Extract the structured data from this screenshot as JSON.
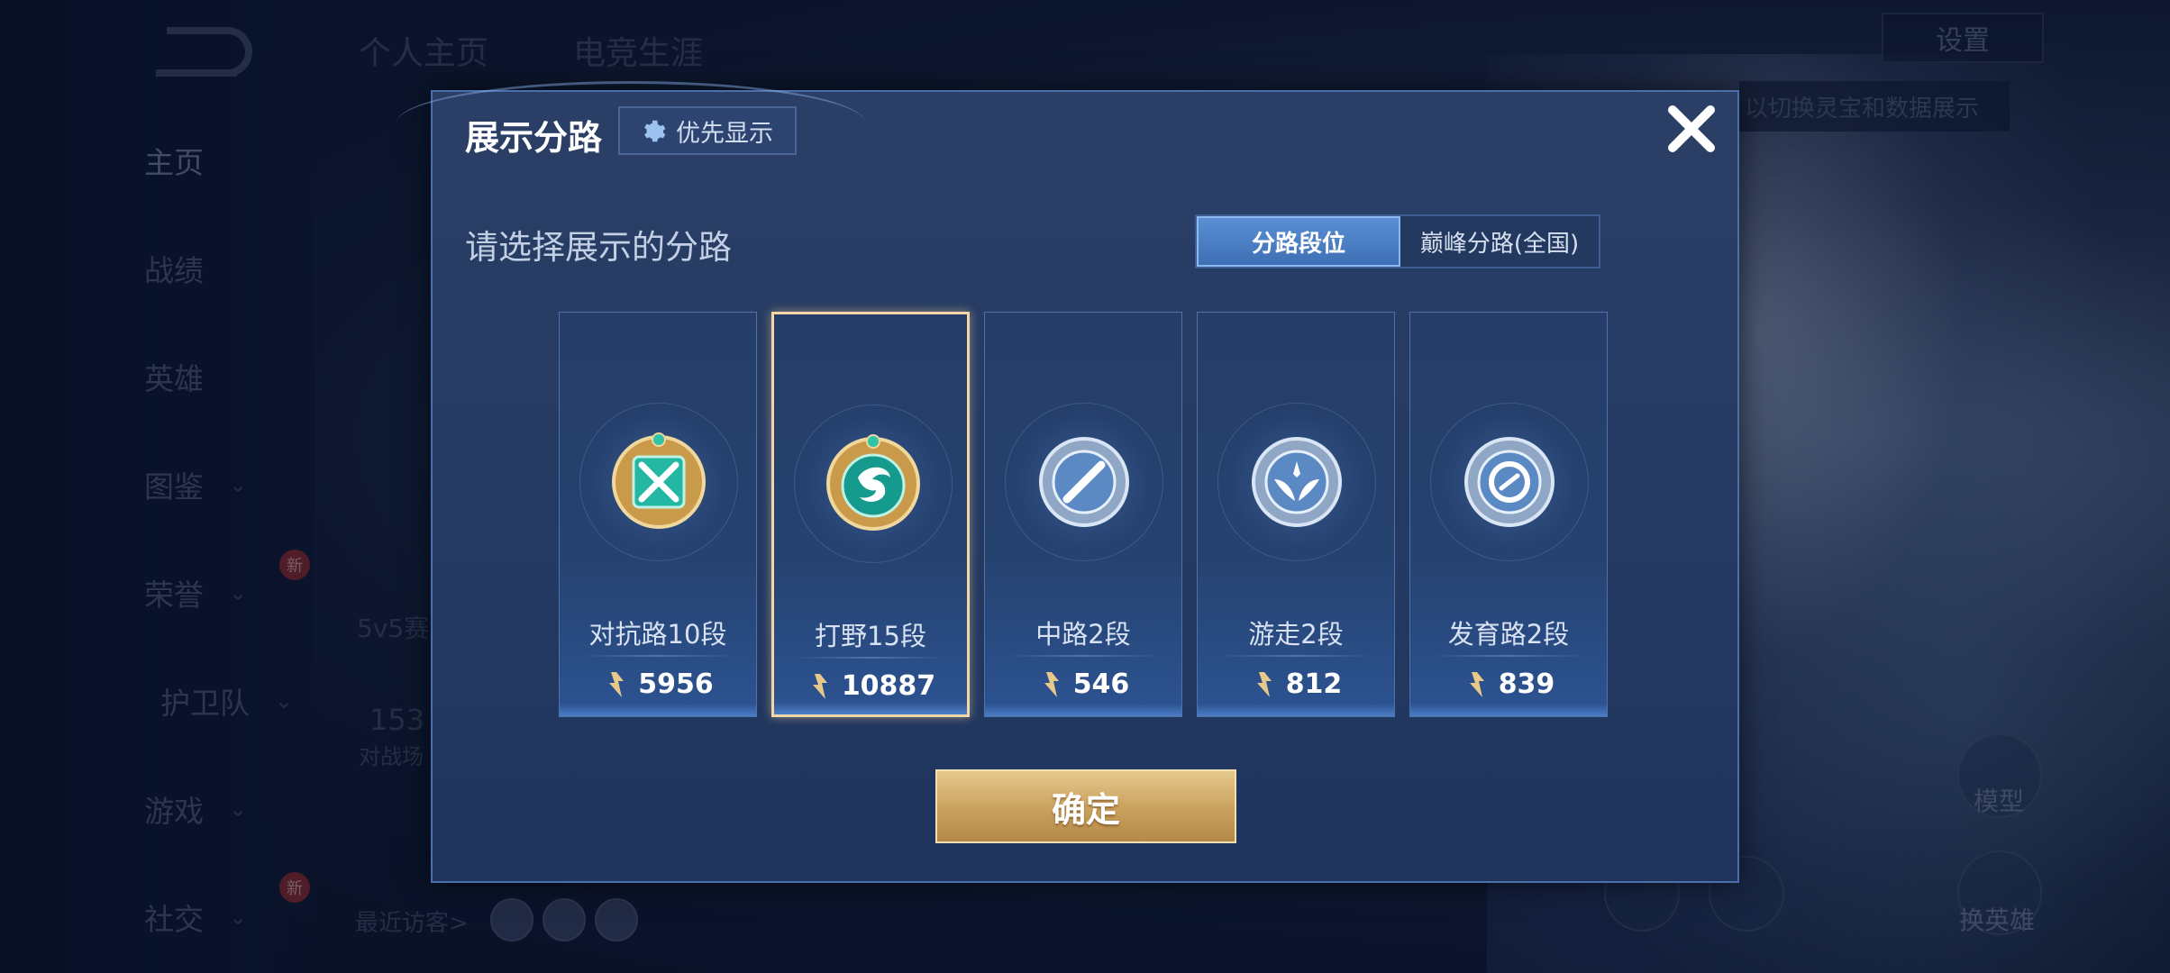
{
  "background": {
    "top_tabs": [
      "个人主页",
      "电竞生涯"
    ],
    "settings_label": "设置",
    "switch_tip": "以切换灵宝和数据展示",
    "sidebar": [
      {
        "label": "主页",
        "active": true
      },
      {
        "label": "战绩"
      },
      {
        "label": "英雄"
      },
      {
        "label": "图鉴",
        "chevron": true
      },
      {
        "label": "荣誉",
        "chevron": true,
        "badge": "新"
      },
      {
        "label": "护卫队",
        "chevron": true
      },
      {
        "label": "游戏",
        "chevron": true
      },
      {
        "label": "社交",
        "chevron": true,
        "badge": "新"
      }
    ],
    "stat_fragment": "5v5赛",
    "count_fragment": "153",
    "count_label_fragment": "对战场",
    "recent_visitors": "最近访客>",
    "right_labels": {
      "model": "模型",
      "switch_hero": "换英雄"
    }
  },
  "modal": {
    "title": "展示分路",
    "priority_label": "优先显示",
    "subtitle": "请选择展示的分路",
    "tabs": [
      {
        "label": "分路段位",
        "active": true
      },
      {
        "label": "巅峰分路(全国)",
        "active": false
      }
    ],
    "lanes": [
      {
        "name": "对抗路10段",
        "score": "5956",
        "icon": "clash-lane-emblem-icon",
        "selected": false
      },
      {
        "name": "打野15段",
        "score": "10887",
        "icon": "jungle-dragon-emblem-icon",
        "selected": true
      },
      {
        "name": "中路2段",
        "score": "546",
        "icon": "mid-lane-emblem-icon",
        "selected": false
      },
      {
        "name": "游走2段",
        "score": "812",
        "icon": "roam-wings-emblem-icon",
        "selected": false
      },
      {
        "name": "发育路2段",
        "score": "839",
        "icon": "farm-lane-emblem-icon",
        "selected": false
      }
    ],
    "confirm_label": "确定"
  },
  "colors": {
    "accent_blue": "#3e6fb5",
    "gold": "#c9a05c",
    "selected_border": "#f1d7a6",
    "emblem_teal": "#1fa7a0",
    "emblem_silver": "#9fb7d6"
  }
}
